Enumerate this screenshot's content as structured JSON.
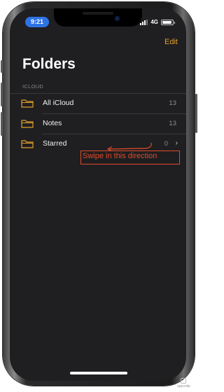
{
  "status_bar": {
    "time": "9:21",
    "network": "4G"
  },
  "header": {
    "edit_label": "Edit",
    "title": "Folders"
  },
  "section_label": "ICLOUD",
  "folders": [
    {
      "label": "All iCloud",
      "count": "13",
      "icon": "folder-icon"
    },
    {
      "label": "Notes",
      "count": "13",
      "icon": "folder-icon"
    },
    {
      "label": "Starred",
      "count": "0",
      "icon": "folder-icon",
      "chevron": "chevron-right-icon"
    }
  ],
  "annotation": {
    "text": "Swipe in this direction",
    "color": "#e24a2a",
    "arrow": "arrow-left-icon"
  },
  "watermark": {
    "text": "appsntip"
  },
  "colors": {
    "accent": "#e0a02c",
    "time_pill": "#2d73e6",
    "background": "#1f1f21"
  }
}
